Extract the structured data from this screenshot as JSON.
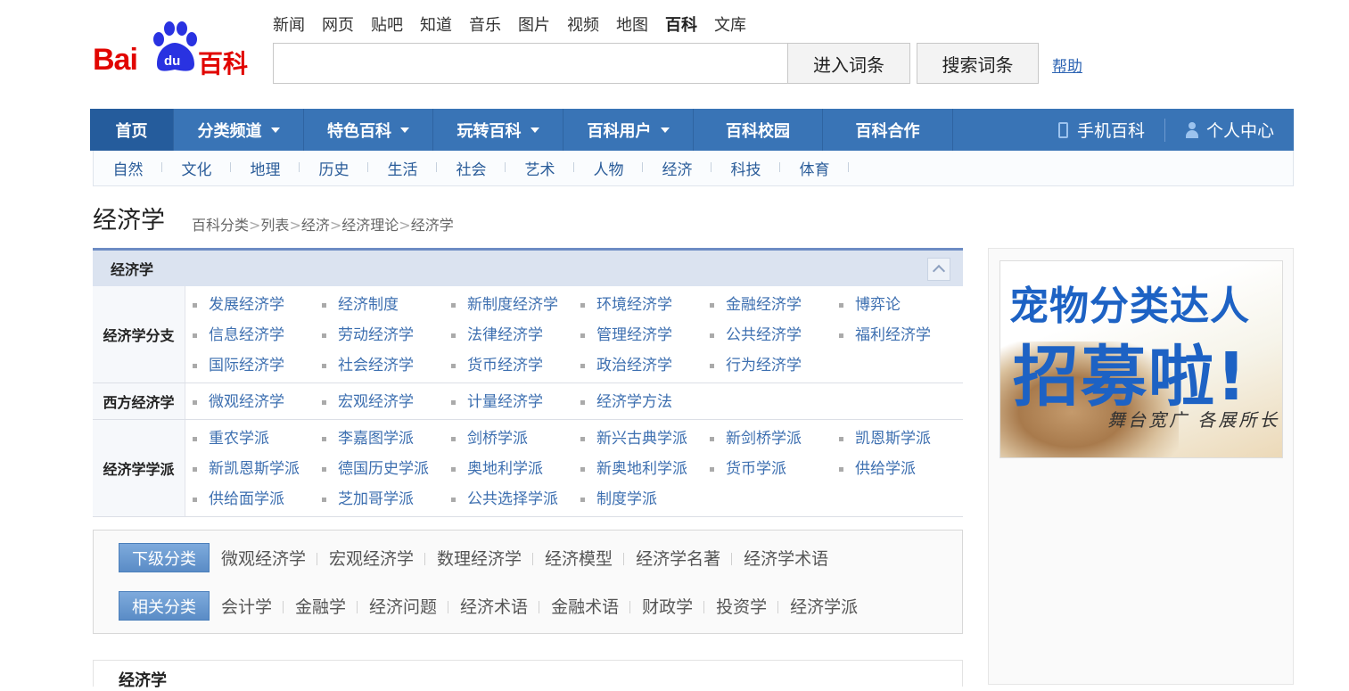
{
  "header": {
    "logo_text": "Bai du 百科",
    "top_links": [
      "新闻",
      "网页",
      "贴吧",
      "知道",
      "音乐",
      "图片",
      "视频",
      "地图",
      "百科",
      "文库"
    ],
    "active_link": "百科",
    "search_placeholder": "",
    "enter_button": "进入词条",
    "search_button": "搜索词条",
    "help": "帮助"
  },
  "mainnav": {
    "items": [
      {
        "label": "首页",
        "dropdown": false
      },
      {
        "label": "分类频道",
        "dropdown": true
      },
      {
        "label": "特色百科",
        "dropdown": true
      },
      {
        "label": "玩转百科",
        "dropdown": true
      },
      {
        "label": "百科用户",
        "dropdown": true
      },
      {
        "label": "百科校园",
        "dropdown": false
      },
      {
        "label": "百科合作",
        "dropdown": false
      }
    ],
    "mobile": "手机百科",
    "user_center": "个人中心"
  },
  "subnav": [
    "自然",
    "文化",
    "地理",
    "历史",
    "生活",
    "社会",
    "艺术",
    "人物",
    "经济",
    "科技",
    "体育"
  ],
  "page": {
    "title": "经济学",
    "breadcrumb": [
      "百科分类",
      "列表",
      "经济",
      "经济理论",
      "经济学"
    ]
  },
  "category": {
    "header": "经济学",
    "rows": [
      {
        "label": "经济学分支",
        "links": [
          "发展经济学",
          "经济制度",
          "新制度经济学",
          "环境经济学",
          "金融经济学",
          "博弈论",
          "信息经济学",
          "劳动经济学",
          "法律经济学",
          "管理经济学",
          "公共经济学",
          "福利经济学",
          "国际经济学",
          "社会经济学",
          "货币经济学",
          "政治经济学",
          "行为经济学"
        ]
      },
      {
        "label": "西方经济学",
        "links": [
          "微观经济学",
          "宏观经济学",
          "计量经济学",
          "经济学方法"
        ]
      },
      {
        "label": "经济学学派",
        "links": [
          "重农学派",
          "李嘉图学派",
          "剑桥学派",
          "新兴古典学派",
          "新剑桥学派",
          "凯恩斯学派",
          "新凯恩斯学派",
          "德国历史学派",
          "奥地利学派",
          "新奥地利学派",
          "货币学派",
          "供给学派",
          "供给面学派",
          "芝加哥学派",
          "公共选择学派",
          "制度学派"
        ]
      }
    ]
  },
  "related": {
    "sub_label": "下级分类",
    "sub_items": [
      "微观经济学",
      "宏观经济学",
      "数理经济学",
      "经济模型",
      "经济学名著",
      "经济学术语"
    ],
    "rel_label": "相关分类",
    "rel_items": [
      "会计学",
      "金融学",
      "经济问题",
      "经济术语",
      "金融术语",
      "财政学",
      "投资学",
      "经济学派"
    ]
  },
  "next_section": "经济学",
  "ad": {
    "line1": "宠物分类达人",
    "line2": "招募啦!",
    "line3": "舞台宽广 各展所长"
  },
  "colors": {
    "nav_bg": "#3974b6",
    "link": "#3d6fb0",
    "logo_red": "#e10601",
    "logo_blue": "#2932e1"
  }
}
